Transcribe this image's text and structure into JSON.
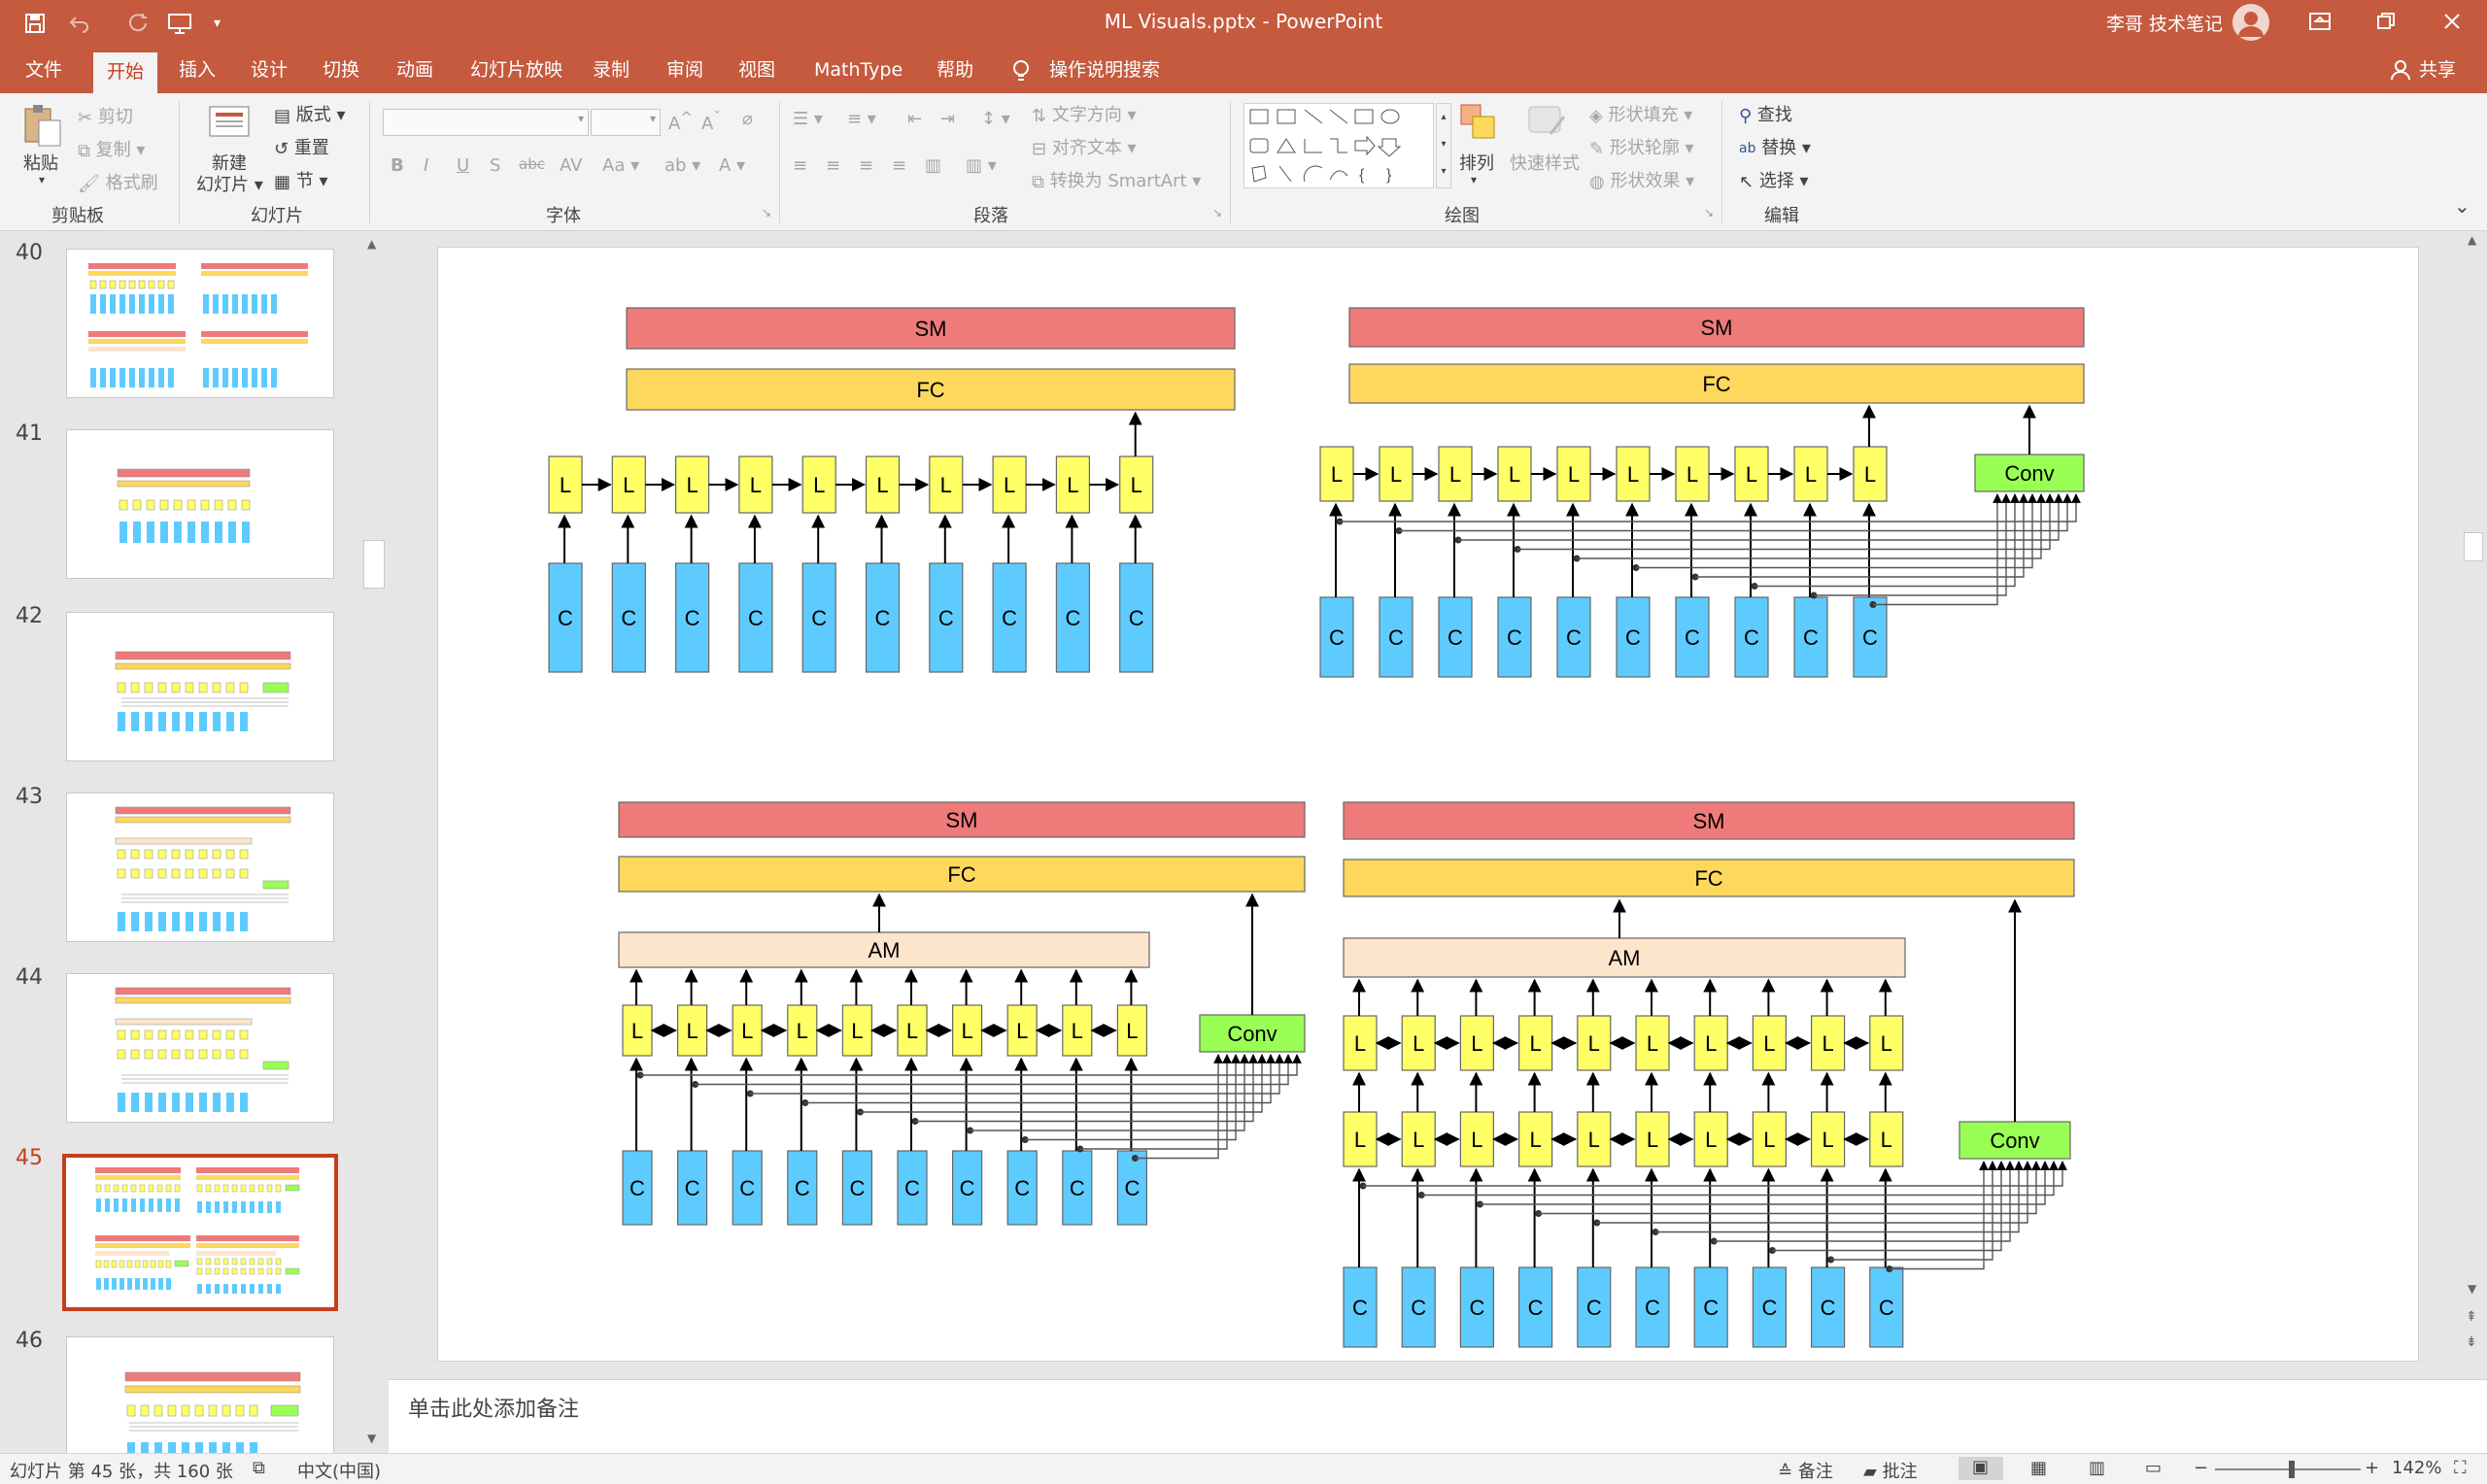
{
  "app": {
    "file_title": "ML Visuals.pptx",
    "separator": "-",
    "app_name": "PowerPoint",
    "user_name": "李哥 技术笔记"
  },
  "tabs": [
    "文件",
    "开始",
    "插入",
    "设计",
    "切换",
    "动画",
    "幻灯片放映",
    "录制",
    "审阅",
    "视图",
    "MathType",
    "帮助"
  ],
  "active_tab": "开始",
  "tell_me": "操作说明搜索",
  "share": "共享",
  "ribbon": {
    "clipboard": {
      "paste": "粘贴",
      "cut": "剪切",
      "copy": "复制",
      "format_painter": "格式刷",
      "label": "剪贴板"
    },
    "slides": {
      "new_slide_line1": "新建",
      "new_slide_line2": "幻灯片",
      "layout": "版式",
      "reset": "重置",
      "section": "节",
      "label": "幻灯片"
    },
    "font": {
      "label": "字体"
    },
    "paragraph": {
      "text_direction": "文字方向",
      "align_text": "对齐文本",
      "convert_smartart": "转换为 SmartArt",
      "label": "段落"
    },
    "drawing": {
      "arrange": "排列",
      "quick_styles": "快速样式",
      "shape_fill": "形状填充",
      "shape_outline": "形状轮廓",
      "shape_effects": "形状效果",
      "label": "绘图"
    },
    "editing": {
      "find": "查找",
      "replace": "替换",
      "select": "选择",
      "label": "编辑"
    }
  },
  "slide_numbers": [
    "40",
    "41",
    "42",
    "43",
    "44",
    "45",
    "46"
  ],
  "selected_slide": "45",
  "notes_placeholder": "单击此处添加备注",
  "status": {
    "slide_info": "幻灯片 第 45 张，共 160 张",
    "language": "中文(中国)",
    "notes": "备注",
    "comments": "批注",
    "zoom": "142%"
  },
  "colors": {
    "accent": "#c55a3f",
    "sm": "#ef7a7a",
    "fc": "#fdd85d",
    "am": "#fde5cc",
    "lstm": "#ffff66",
    "cell": "#5ecbff",
    "conv": "#99ff55"
  },
  "diagram_labels": {
    "sm": "SM",
    "fc": "FC",
    "am": "AM",
    "lstm": "L",
    "cell": "C",
    "conv": "Conv"
  }
}
